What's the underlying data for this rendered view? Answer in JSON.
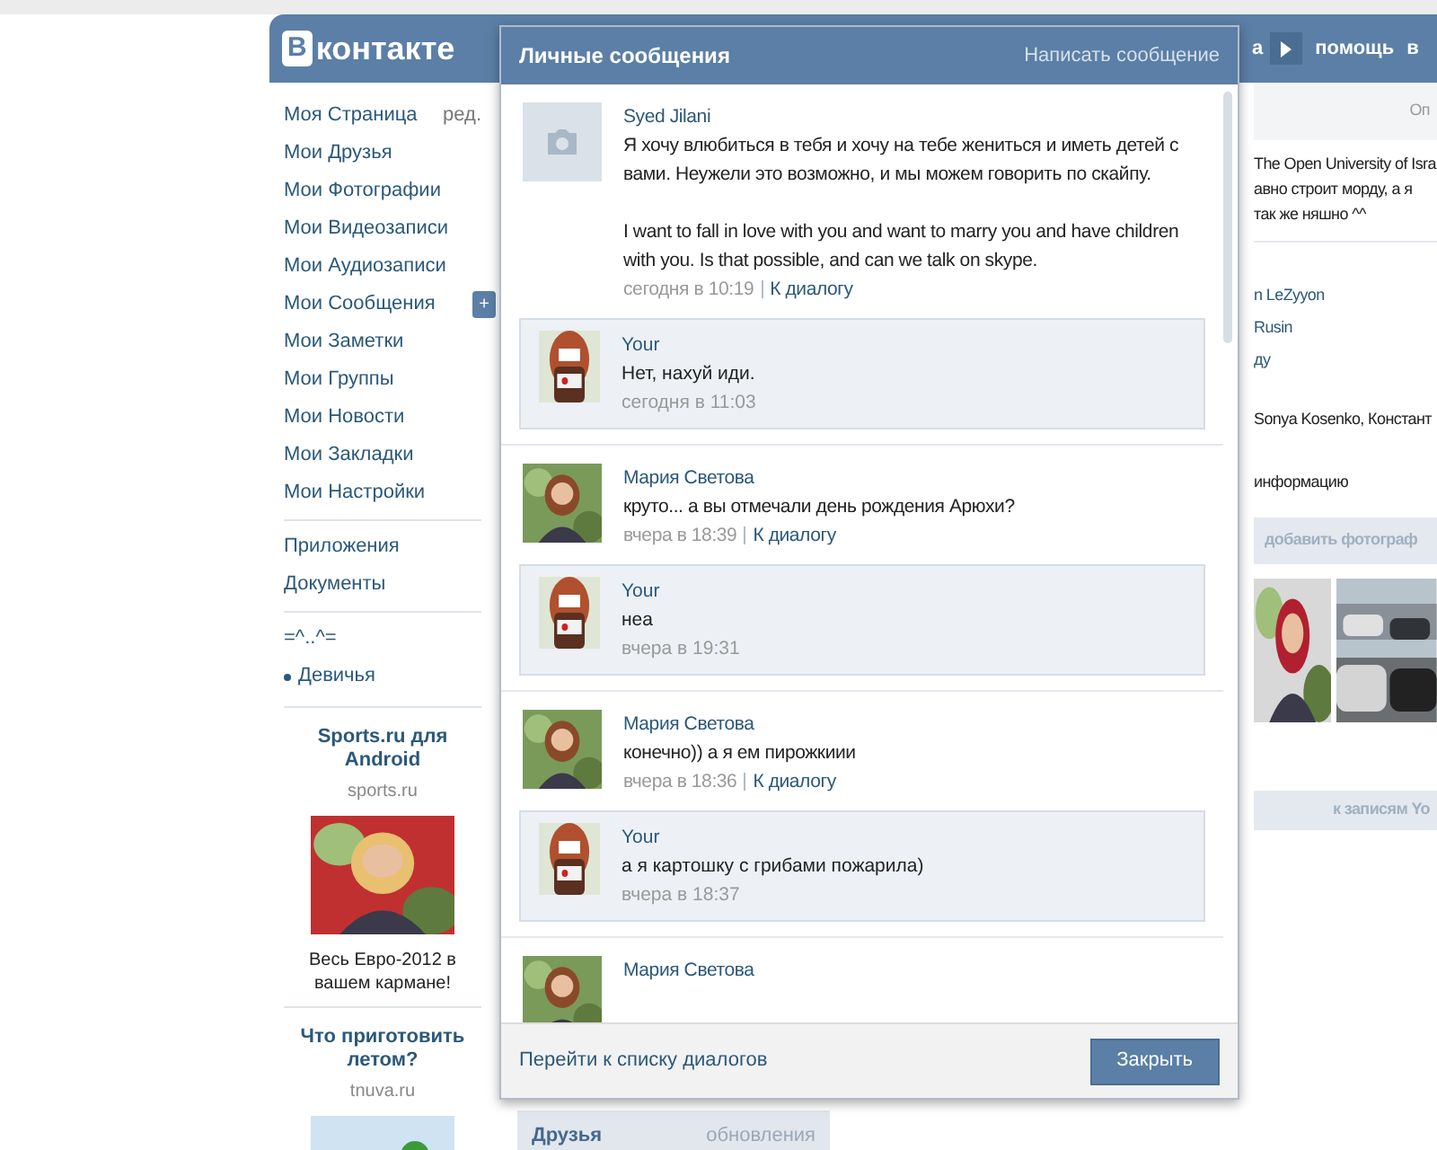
{
  "header": {
    "logo_mark": "В",
    "logo_text": "контакте",
    "nav": [
      "а",
      "помощь",
      "в"
    ]
  },
  "sidebar": {
    "menu": [
      {
        "label": "Моя Страница",
        "edit": "ред."
      },
      {
        "label": "Мои Друзья"
      },
      {
        "label": "Мои Фотографии"
      },
      {
        "label": "Мои Видеозаписи"
      },
      {
        "label": "Мои Аудиозаписи"
      },
      {
        "label": "Мои Сообщения",
        "add": "+"
      },
      {
        "label": "Мои Заметки"
      },
      {
        "label": "Мои Группы"
      },
      {
        "label": "Мои Новости"
      },
      {
        "label": "Мои Закладки"
      },
      {
        "label": "Мои Настройки"
      }
    ],
    "apps": [
      "Приложения",
      "Документы"
    ],
    "extras": [
      {
        "label": "=^..^=",
        "bullet": false
      },
      {
        "label": "Девичья",
        "bullet": true
      }
    ],
    "ads": [
      {
        "title": "Sports.ru для Android",
        "domain": "sports.ru",
        "caption": "Весь Евро-2012 в вашем кармане!"
      },
      {
        "title": "Что приготовить летом?",
        "domain": "tnuva.ru"
      }
    ]
  },
  "popup": {
    "title": "Личные сообщения",
    "compose": "Написать сообщение",
    "threads": [
      {
        "name": "Syed Jilani",
        "kind": "placeholder",
        "paragraphs": [
          "Я хочу влюбиться в тебя и хочу на тебе жениться и иметь детей с вами. Неужели это возможно, и мы можем говорить по скайпу.",
          "I want to fall in love with you and want to marry you and have children with you. Is that possible, and can we talk on skype."
        ],
        "time": "сегодня в 10:19",
        "link": "К диалогу",
        "reply": {
          "name": "Your",
          "text": "Нет, нахуй иди.",
          "time": "сегодня в 11:03"
        }
      },
      {
        "name": "Мария Светова",
        "kind": "picture",
        "paragraphs": [
          "круто... а вы отмечали день рождения Арюхи?"
        ],
        "time": "вчера в 18:39",
        "link": "К диалогу",
        "reply": {
          "name": "Your",
          "text": "неа",
          "time": "вчера в 19:31"
        }
      },
      {
        "name": "Мария Светова",
        "kind": "picture",
        "paragraphs": [
          "конечно)) а я ем пирожкиии"
        ],
        "time": "вчера в 18:36",
        "link": "К диалогу",
        "reply": {
          "name": "Your",
          "text": "а я картошку с грибами пожарила)",
          "time": "вчера в 18:37"
        }
      },
      {
        "name": "Мария Светова",
        "kind": "picture"
      }
    ],
    "all_dialogs": "Перейти к списку диалогов",
    "close": "Закрыть"
  },
  "background": {
    "friends_title": "Друзья",
    "friends_updates": "обновления",
    "right": {
      "band": "Оп",
      "lines_1": [
        "The Open University of Isra",
        "авно строит морду, а я",
        "так же няшно ^^"
      ],
      "lines_2": [
        "n LeZyyon",
        "Rusin",
        "ду"
      ],
      "names": "Sonya Kosenko, Констант",
      "info": "информацию",
      "add_photos": "добавить фотограф",
      "to_posts": "к записям Yo"
    }
  }
}
